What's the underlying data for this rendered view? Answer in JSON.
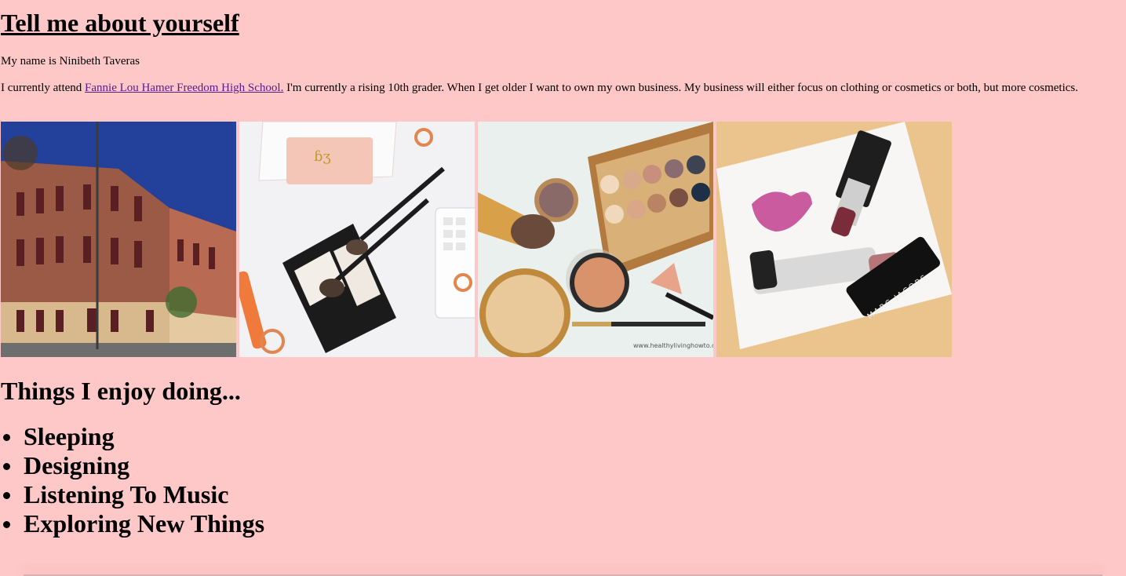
{
  "header": {
    "title": "Tell me about yourself"
  },
  "about": {
    "name_line": "My name is Ninibeth Taveras",
    "intro_prefix": "I currently attend ",
    "school_link": "Fannie Lou Hamer Freedom High School.",
    "intro_suffix": " I'm currently a rising 10th grader. When I get older I want to own my own business. My business will either focus on clothing or cosmetics or both, but more cosmetics."
  },
  "gallery": {
    "photos": [
      {
        "name": "school-building-photo"
      },
      {
        "name": "makeup-compact-photo"
      },
      {
        "name": "eyeshadow-palette-photo",
        "watermark": "www.healthylivinghowto.com"
      },
      {
        "name": "lipstick-photo",
        "brand": "MARC JACOBS"
      }
    ]
  },
  "enjoy": {
    "heading": "Things I enjoy doing...",
    "items": [
      "Sleeping",
      "Designing",
      "Listening To Music",
      "Exploring New Things"
    ]
  }
}
